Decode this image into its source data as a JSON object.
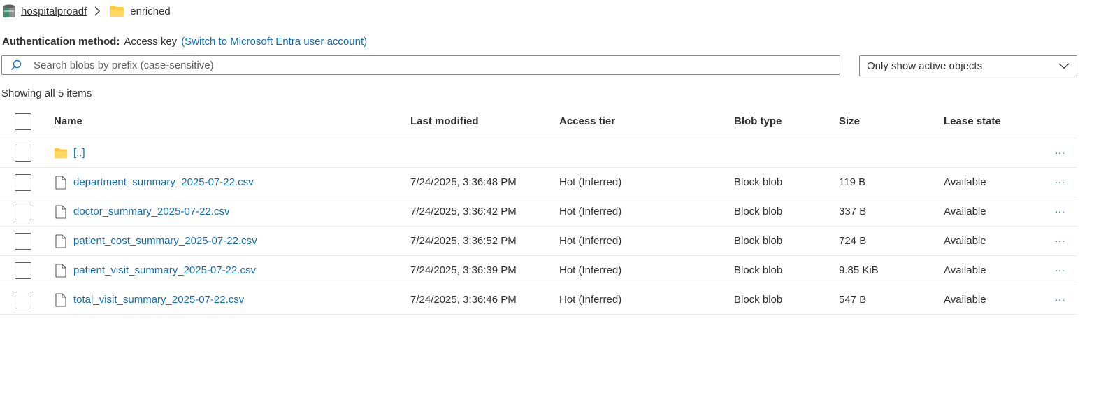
{
  "breadcrumb": {
    "account": "hospitalproadf",
    "container": "enriched"
  },
  "auth": {
    "label": "Authentication method:",
    "value": "Access key",
    "switch_link": "(Switch to Microsoft Entra user account)"
  },
  "search": {
    "placeholder": "Search blobs by prefix (case-sensitive)",
    "value": ""
  },
  "filter": {
    "selected": "Only show active objects"
  },
  "status": {
    "count_text": "Showing all 5 items"
  },
  "table": {
    "headers": {
      "name": "Name",
      "modified": "Last modified",
      "tier": "Access tier",
      "type": "Blob type",
      "size": "Size",
      "lease": "Lease state"
    },
    "parent": {
      "name": "[..]",
      "more": "···"
    },
    "rows": [
      {
        "name": "department_summary_2025-07-22.csv",
        "modified": "7/24/2025, 3:36:48 PM",
        "tier": "Hot (Inferred)",
        "type": "Block blob",
        "size": "119 B",
        "lease": "Available",
        "more": "···"
      },
      {
        "name": "doctor_summary_2025-07-22.csv",
        "modified": "7/24/2025, 3:36:42 PM",
        "tier": "Hot (Inferred)",
        "type": "Block blob",
        "size": "337 B",
        "lease": "Available",
        "more": "···"
      },
      {
        "name": "patient_cost_summary_2025-07-22.csv",
        "modified": "7/24/2025, 3:36:52 PM",
        "tier": "Hot (Inferred)",
        "type": "Block blob",
        "size": "724 B",
        "lease": "Available",
        "more": "···"
      },
      {
        "name": "patient_visit_summary_2025-07-22.csv",
        "modified": "7/24/2025, 3:36:39 PM",
        "tier": "Hot (Inferred)",
        "type": "Block blob",
        "size": "9.85 KiB",
        "lease": "Available",
        "more": "···"
      },
      {
        "name": "total_visit_summary_2025-07-22.csv",
        "modified": "7/24/2025, 3:36:46 PM",
        "tier": "Hot (Inferred)",
        "type": "Block blob",
        "size": "547 B",
        "lease": "Available",
        "more": "···"
      }
    ]
  },
  "colors": {
    "link": "#0f6cbd",
    "folder": "#ffc83d",
    "border": "#8a8886",
    "divider": "#edebe9"
  },
  "icons": {
    "account": "storage-account-icon",
    "separator": "chevron-right-icon",
    "folder": "folder-icon",
    "search": "search-icon",
    "dropdown": "chevron-down-icon",
    "file": "document-icon",
    "more": "more-options-icon"
  }
}
